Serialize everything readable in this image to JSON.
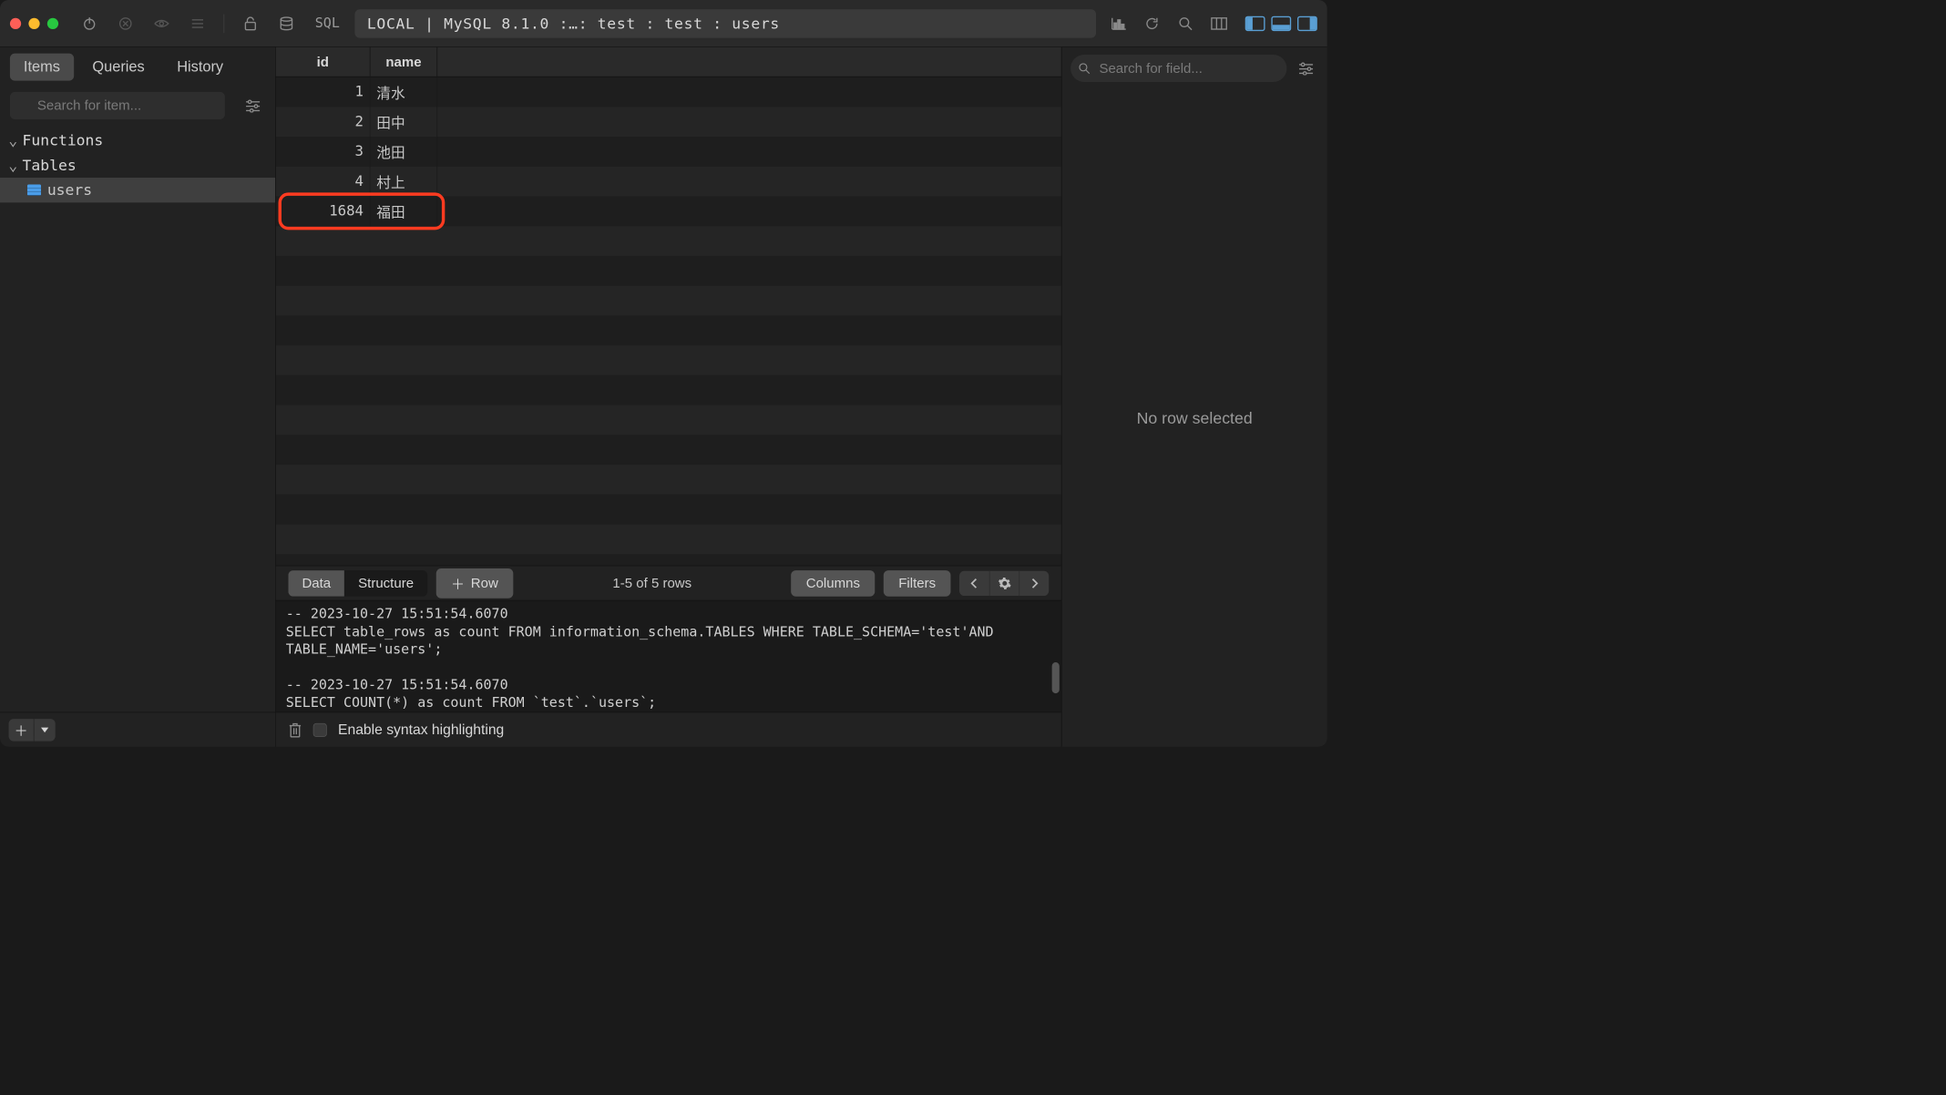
{
  "titlebar": {
    "sql_label": "SQL",
    "breadcrumb": "LOCAL  |  MySQL 8.1.0 :…:  test : test : users"
  },
  "sidebar": {
    "tabs": {
      "items": "Items",
      "queries": "Queries",
      "history": "History"
    },
    "search_placeholder": "Search for item...",
    "tree": {
      "functions_label": "Functions",
      "tables_label": "Tables",
      "items": [
        {
          "name": "users"
        }
      ]
    }
  },
  "table": {
    "columns": {
      "id": "id",
      "name": "name"
    },
    "rows": [
      {
        "id": "1",
        "name": "清水"
      },
      {
        "id": "2",
        "name": "田中"
      },
      {
        "id": "3",
        "name": "池田"
      },
      {
        "id": "4",
        "name": "村上"
      },
      {
        "id": "1684",
        "name": "福田"
      }
    ],
    "highlight_row_index": 4
  },
  "center_toolbar": {
    "data_label": "Data",
    "structure_label": "Structure",
    "row_label": "Row",
    "rows_status": "1-5 of 5 rows",
    "columns_label": "Columns",
    "filters_label": "Filters"
  },
  "sql_log": {
    "text": "-- 2023-10-27 15:51:54.6070\nSELECT table_rows as count FROM information_schema.TABLES WHERE TABLE_SCHEMA='test'AND TABLE_NAME='users';\n\n-- 2023-10-27 15:51:54.6070\nSELECT COUNT(*) as count FROM `test`.`users`;",
    "syntax_highlight_label": "Enable syntax highlighting"
  },
  "right_panel": {
    "search_placeholder": "Search for field...",
    "empty_label": "No row selected"
  }
}
